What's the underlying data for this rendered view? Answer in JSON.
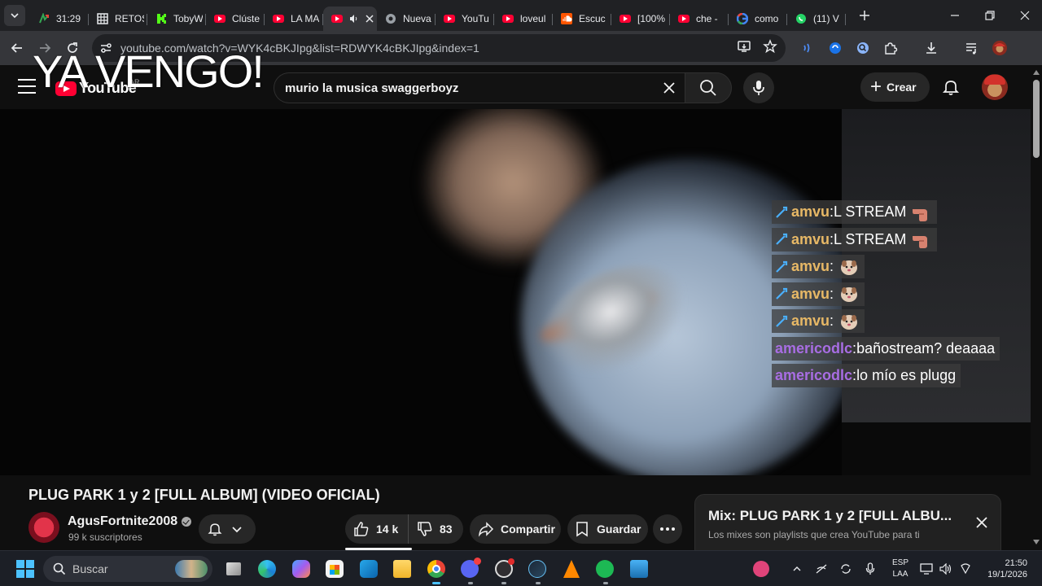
{
  "browser": {
    "tabs": [
      {
        "label": "31:29",
        "icon": "stock-arrows-icon"
      },
      {
        "label": "RETOS",
        "icon": "grid-icon"
      },
      {
        "label": "TobyW",
        "icon": "kick-icon"
      },
      {
        "label": "Clúste",
        "icon": "youtube-icon"
      },
      {
        "label": "LA MA",
        "icon": "youtube-icon"
      },
      {
        "label": "",
        "icon": "youtube-icon",
        "active": true
      },
      {
        "label": "Nueva",
        "icon": "chrome-icon"
      },
      {
        "label": "YouTu",
        "icon": "youtube-icon"
      },
      {
        "label": "loveul",
        "icon": "youtube-icon"
      },
      {
        "label": "Escuc",
        "icon": "soundcloud-icon"
      },
      {
        "label": "[100%",
        "icon": "youtube-icon"
      },
      {
        "label": "che -",
        "icon": "youtube-icon"
      },
      {
        "label": "como",
        "icon": "google-icon"
      },
      {
        "label": "(11) V",
        "icon": "whatsapp-icon"
      }
    ],
    "url": "youtube.com/watch?v=WYK4cBKJIpg&list=RDWYK4cBKJIpg&index=1"
  },
  "youtube": {
    "logo_text": "YouTube",
    "country_code": "AR",
    "search_value": "murio la musica swaggerboyz",
    "create_label": "Crear",
    "overlay_text": "YA VENGO!"
  },
  "chat": [
    {
      "user": "amvu",
      "sep": ":",
      "message": " L STREAM",
      "emote": "hand-emote",
      "color": "#e7b866"
    },
    {
      "user": "amvu",
      "sep": ":",
      "message": " L STREAM",
      "emote": "hand-emote",
      "color": "#e7b866"
    },
    {
      "user": "amvu",
      "sep": ":",
      "message": " ",
      "emote": "dog-emote",
      "color": "#e7b866"
    },
    {
      "user": "amvu",
      "sep": ":",
      "message": " ",
      "emote": "dog-emote",
      "color": "#e7b866"
    },
    {
      "user": "amvu",
      "sep": ":",
      "message": " ",
      "emote": "dog-emote",
      "color": "#e7b866"
    },
    {
      "user": "americodlc",
      "sep": ":",
      "message": " bañostream? deaaaa",
      "emote": "",
      "color": "#a86de3"
    },
    {
      "user": "americodlc",
      "sep": ":",
      "message": " lo mío es plugg",
      "emote": "",
      "color": "#a86de3"
    }
  ],
  "video": {
    "title": "PLUG PARK 1 y 2 [FULL ALBUM] (VIDEO OFICIAL)",
    "channel": "AgusFortnite2008",
    "subscribers": "99 k suscriptores",
    "likes": "14 k",
    "dislikes": "83",
    "share_label": "Compartir",
    "save_label": "Guardar"
  },
  "mix": {
    "title": "Mix: PLUG PARK 1 y 2 [FULL ALBU...",
    "subtitle": "Los mixes son playlists que crea YouTube para ti"
  },
  "taskbar": {
    "search_placeholder": "Buscar",
    "lang_line1": "ESP",
    "lang_line2": "LAA",
    "time": "21:50",
    "date": "19/1/2026"
  },
  "colors": {
    "youtube_red": "#ff0033",
    "chat_amvu": "#e7b866",
    "chat_americodlc": "#a86de3",
    "accent_windows": "#4cc2ff"
  }
}
